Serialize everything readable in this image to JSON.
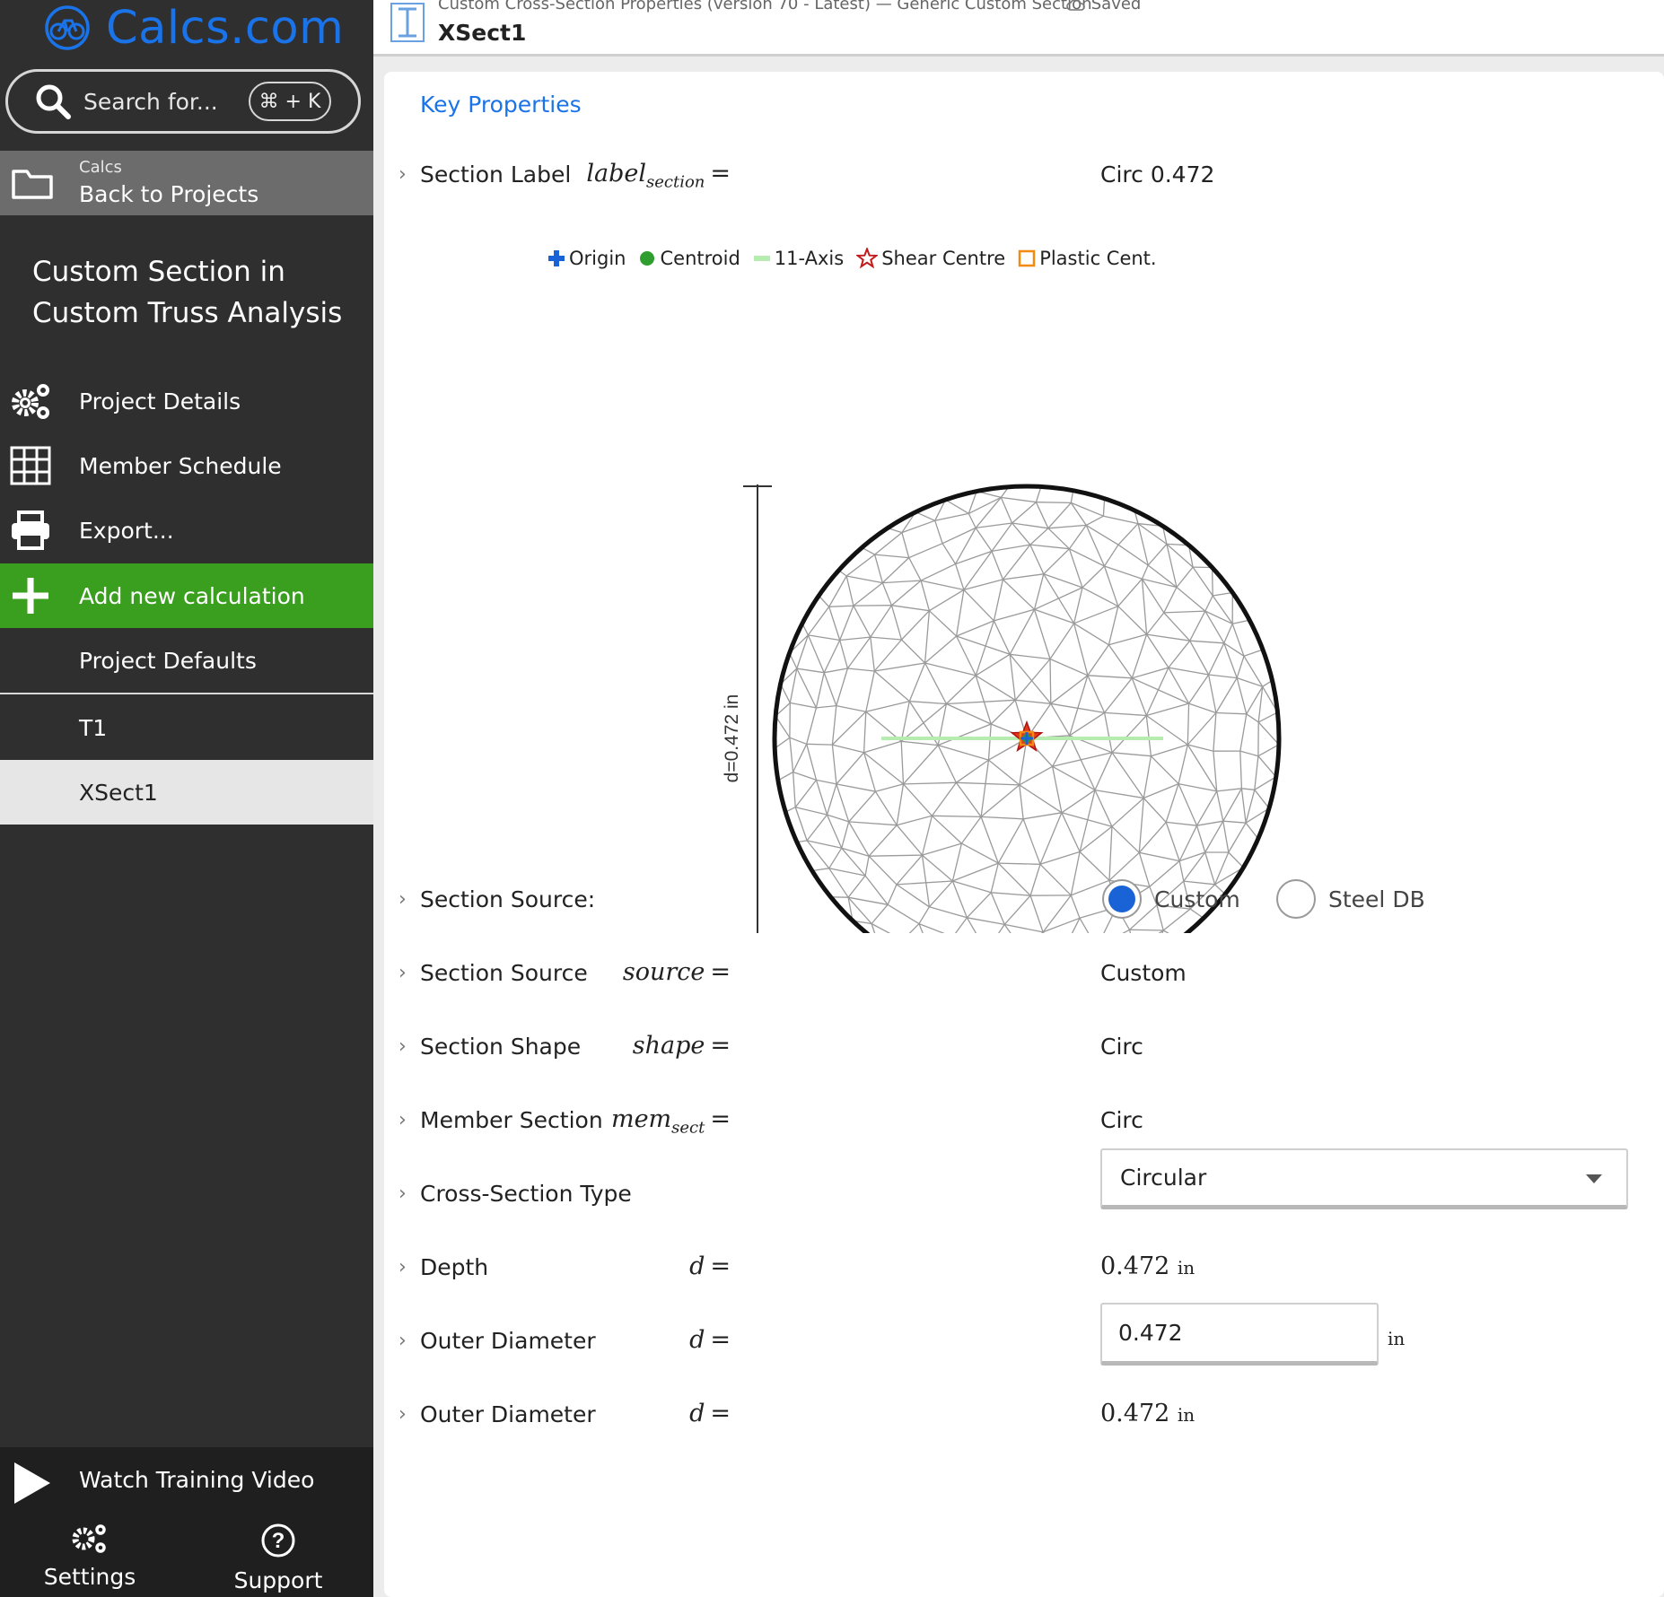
{
  "brand": {
    "name": "Calcs.com",
    "accent": "#1a73e8"
  },
  "search": {
    "placeholder": "Search for...",
    "shortcut": "⌘ + K"
  },
  "back": {
    "small": "Calcs",
    "label": "Back to Projects"
  },
  "project": {
    "title": "Custom Section in Custom Truss Analysis"
  },
  "nav": {
    "project_details": "Project Details",
    "member_schedule": "Member Schedule",
    "export": "Export...",
    "add_new": "Add new calculation",
    "project_defaults": "Project Defaults",
    "t1": "T1",
    "xsect1": "XSect1",
    "add_color": "#3a9e1e"
  },
  "bottom": {
    "watch": "Watch Training Video",
    "settings": "Settings",
    "support": "Support"
  },
  "header": {
    "breadcrumb": "Custom Cross-Section Properties (version 70 - Latest) — Generic Custom Section",
    "saved": "Saved",
    "title": "XSect1"
  },
  "main": {
    "key_properties": "Key Properties",
    "section_label": {
      "label": "Section Label",
      "sym": "label",
      "sub": "section",
      "value": "Circ 0.472"
    },
    "legend": [
      "Origin",
      "Centroid",
      "11-Axis",
      "Shear Centre",
      "Plastic Cent."
    ],
    "dimension_label": "d=0.472 in",
    "section_source_radio": {
      "label": "Section Source:",
      "options": [
        "Custom",
        "Steel DB"
      ],
      "selected": "Custom"
    },
    "section_source": {
      "label": "Section Source",
      "sym": "source",
      "value": "Custom"
    },
    "section_shape": {
      "label": "Section Shape",
      "sym": "shape",
      "value": "Circ"
    },
    "member_section": {
      "label": "Member Section",
      "sym": "mem",
      "sub": "sect",
      "value": "Circ"
    },
    "cross_section_type": {
      "label": "Cross-Section Type",
      "value": "Circular"
    },
    "depth": {
      "label": "Depth",
      "sym": "d",
      "value": "0.472",
      "unit": "in"
    },
    "outer_diameter_input": {
      "label": "Outer Diameter",
      "sym": "d",
      "value": "0.472",
      "unit": "in"
    },
    "outer_diameter": {
      "label": "Outer Diameter",
      "sym": "d",
      "value": "0.472",
      "unit": "in"
    }
  }
}
